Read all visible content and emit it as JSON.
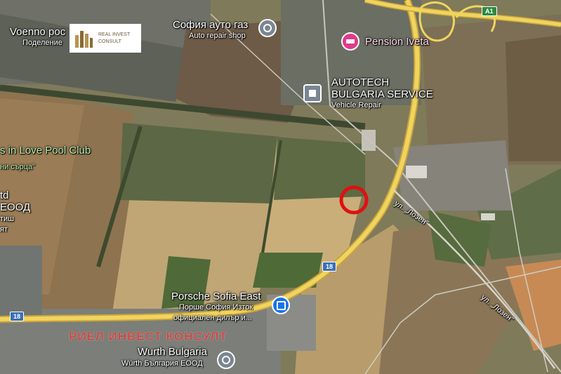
{
  "logo": {
    "line1": "REAL INVEST",
    "line2": "CONSULT"
  },
  "watermark": "РИЕЛ ИНВЕСТ КОНСУЛТ",
  "places": {
    "voenno": {
      "name": "Voenno poc",
      "sub": "Поделение"
    },
    "sofia_auto_gaz": {
      "name": "София ауто газ",
      "sub": "Auto repair shop"
    },
    "pension": {
      "name": "Pension Iveta"
    },
    "autotech": {
      "line1": "AUTOTECH",
      "line2": "BULGARIA SERVICE",
      "sub": "Vehicle Repair"
    },
    "pool_club": {
      "name": "s in Love Pool Club",
      "sub": "ни сърца\""
    },
    "eood_left": {
      "line1": "td",
      "line2": "ЕООД",
      "line3": "тиш",
      "line4": "ят"
    },
    "porsche": {
      "name": "Porsche Sofia East",
      "sub1": "Порше София Изток",
      "sub2": "официален дилър и..."
    },
    "wurth": {
      "name": "Wurth Bulgaria",
      "sub": "Würth България ЕООД"
    }
  },
  "roads": {
    "lozen_1": "ул. „Лозен\"",
    "lozen_2": "ул. „Лозен\"",
    "shield_18_a": "18",
    "shield_18_b": "18",
    "shield_a1": "A1"
  },
  "colors": {
    "highway": "#e8c94a",
    "marker_circle": "#e01010",
    "pin_gray": "#7a8691",
    "pin_pink": "#e0398a",
    "pin_blue": "#1a73e8"
  },
  "icons": {
    "auto_repair_pin": "wrench-pin-icon",
    "pension_pin": "bed-pin-icon",
    "autotech_pin": "square-pin-icon",
    "porsche_pin": "shopping-bag-pin-icon",
    "wurth_pin": "wrench-pin-icon"
  }
}
